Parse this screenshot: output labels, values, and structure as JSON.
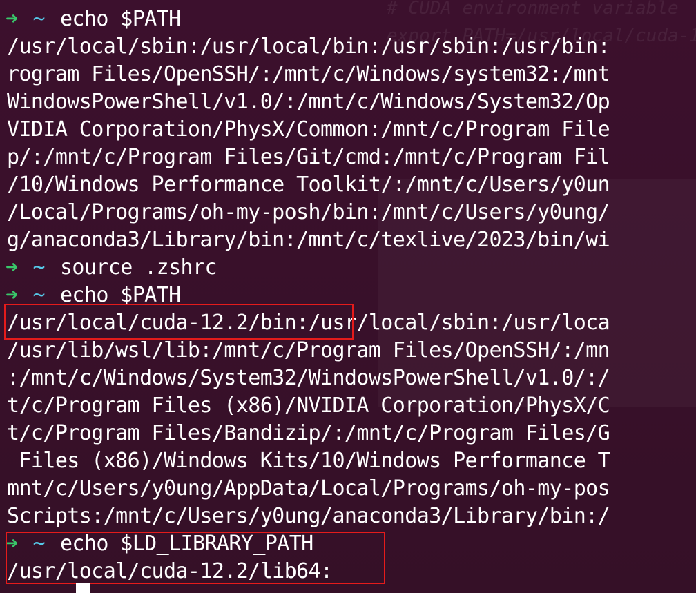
{
  "ghost_text": "# CUDA environment variable\nexport PATH=/usr/local/cuda-1",
  "prompt": {
    "arrow": "➜",
    "dir": "~"
  },
  "lines": [
    {
      "type": "prompt",
      "cmd": "echo $PATH"
    },
    {
      "type": "output",
      "text": "/usr/local/sbin:/usr/local/bin:/usr/sbin:/usr/bin:"
    },
    {
      "type": "output",
      "text": "rogram Files/OpenSSH/:/mnt/c/Windows/system32:/mnt"
    },
    {
      "type": "output",
      "text": "WindowsPowerShell/v1.0/:/mnt/c/Windows/System32/Op"
    },
    {
      "type": "output",
      "text": "VIDIA Corporation/PhysX/Common:/mnt/c/Program File"
    },
    {
      "type": "output",
      "text": "p/:/mnt/c/Program Files/Git/cmd:/mnt/c/Program Fil"
    },
    {
      "type": "output",
      "text": "/10/Windows Performance Toolkit/:/mnt/c/Users/y0un"
    },
    {
      "type": "output",
      "text": "/Local/Programs/oh-my-posh/bin:/mnt/c/Users/y0ung/"
    },
    {
      "type": "output",
      "text": "g/anaconda3/Library/bin:/mnt/c/texlive/2023/bin/wi"
    },
    {
      "type": "prompt",
      "cmd": "source .zshrc"
    },
    {
      "type": "prompt",
      "cmd": "echo $PATH"
    },
    {
      "type": "output",
      "text": "/usr/local/cuda-12.2/bin:/usr/local/sbin:/usr/loca"
    },
    {
      "type": "output",
      "text": "/usr/lib/wsl/lib:/mnt/c/Program Files/OpenSSH/:/mn"
    },
    {
      "type": "output",
      "text": ":/mnt/c/Windows/System32/WindowsPowerShell/v1.0/:/"
    },
    {
      "type": "output",
      "text": "t/c/Program Files (x86)/NVIDIA Corporation/PhysX/C"
    },
    {
      "type": "output",
      "text": "t/c/Program Files/Bandizip/:/mnt/c/Program Files/G"
    },
    {
      "type": "output",
      "text": " Files (x86)/Windows Kits/10/Windows Performance T"
    },
    {
      "type": "output",
      "text": "mnt/c/Users/y0ung/AppData/Local/Programs/oh-my-pos"
    },
    {
      "type": "output",
      "text": "Scripts:/mnt/c/Users/y0ung/anaconda3/Library/bin:/"
    },
    {
      "type": "prompt",
      "cmd": "echo $LD_LIBRARY_PATH"
    },
    {
      "type": "output",
      "text": "/usr/local/cuda-12.2/lib64:"
    }
  ],
  "colors": {
    "background": "#3c102d",
    "prompt_arrow": "#39c76a",
    "prompt_dir": "#56c8e8",
    "highlight_box": "#e51b1b",
    "text": "#ffffff"
  }
}
